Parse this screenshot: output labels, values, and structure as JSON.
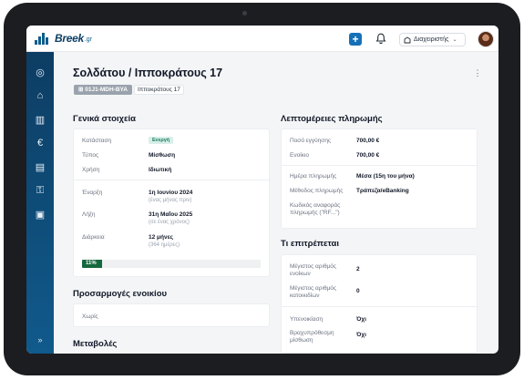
{
  "header": {
    "logo_text": "Breek",
    "logo_suffix": ".gr",
    "add_label": "+",
    "manager_label": "Διαχειριστής",
    "icons": [
      "bell-icon",
      "building-icon",
      "chevron-down-icon",
      "plus-icon"
    ]
  },
  "sidebar": {
    "items": [
      {
        "icon": "dashboard-icon",
        "glyph": "◎"
      },
      {
        "icon": "properties-icon",
        "glyph": "⌂"
      },
      {
        "icon": "buildings-icon",
        "glyph": "▥"
      },
      {
        "icon": "euro-icon",
        "glyph": "€"
      },
      {
        "icon": "documents-icon",
        "glyph": "▤"
      },
      {
        "icon": "key-icon",
        "glyph": "⚿"
      },
      {
        "icon": "contacts-icon",
        "glyph": "▣"
      }
    ],
    "expand_glyph": "»"
  },
  "page": {
    "title": "Σολδάτου / Ιπποκράτους 17",
    "code": "01J1-MDH-BYA",
    "address": "Ιπποκράτους 17"
  },
  "general": {
    "title": "Γενικά στοιχεία",
    "status_label": "Κατάσταση",
    "status_value": "Ενεργή",
    "type_label": "Τύπος",
    "type_value": "Μίσθωση",
    "use_label": "Χρήση",
    "use_value": "Ιδιωτική",
    "start_label": "Έναρξη",
    "start_value": "1η Ιουνίου 2024",
    "start_sub": "(ένας μήνας πριν)",
    "end_label": "Λήξη",
    "end_value": "31η Μαΐου 2025",
    "end_sub": "(σε ένας χρόνος)",
    "duration_label": "Διάρκεια",
    "duration_value": "12 μήνες",
    "duration_sub": "(364 ημέρες)",
    "progress_label": "11%",
    "progress_fraction": 0.11
  },
  "adjustments": {
    "title": "Προσαρμογές ενοικίου",
    "value": "Χωρίς"
  },
  "changes": {
    "title": "Μεταβολές"
  },
  "payment": {
    "title": "Λεπτομέρειες πληρωμής",
    "deposit_label": "Ποσό εγγύησης",
    "deposit_value": "700,00 €",
    "rent_label": "Ενοίκιο",
    "rent_value": "700,00 €",
    "day_label": "Ημέρα πληρωμής",
    "day_value": "Μέσα (15η του μήνα)",
    "method_label": "Μέθοδος πληρωμής",
    "method_value": "Τράπεζα/eBanking",
    "ref_label": "Κωδικός αναφοράς πληρωμής (\"RF...\")"
  },
  "allowed": {
    "title": "Τι επιτρέπεται",
    "tenants_label": "Μέγιστος αριθμός ενοίκων",
    "tenants_value": "2",
    "pets_label": "Μέγιστος αριθμός κατοικιδίων",
    "pets_value": "0",
    "sublet_label": "Υπενοικίαση",
    "sublet_value": "Όχι",
    "short_label": "Βραχυπρόθεσμη μίσθωση",
    "short_value": "Όχι"
  }
}
